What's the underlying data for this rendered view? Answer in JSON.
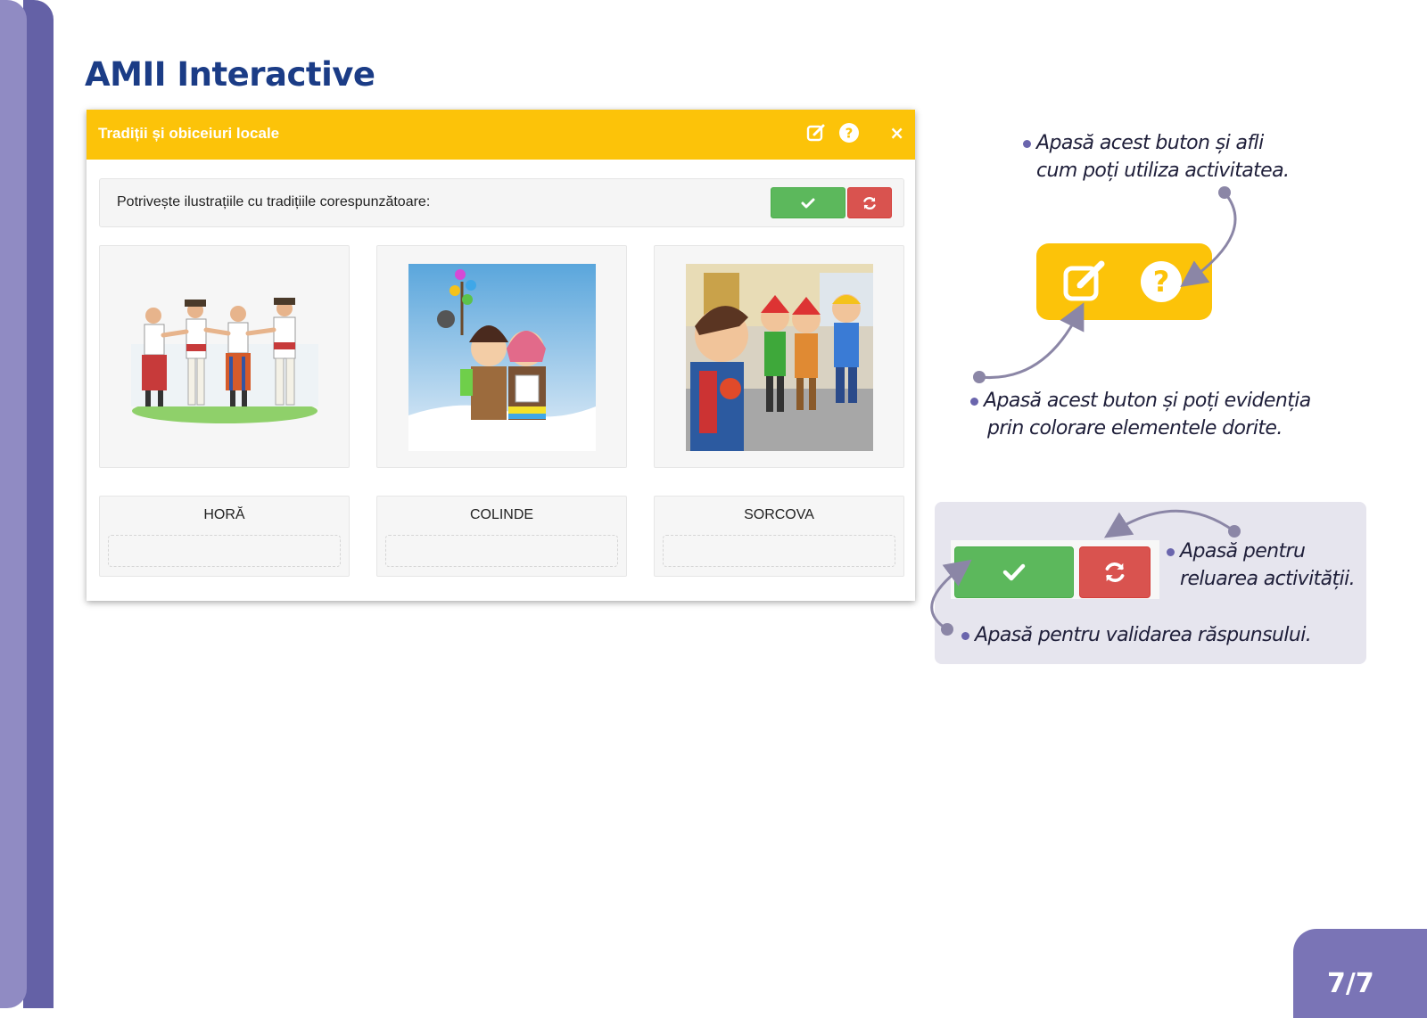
{
  "page": {
    "title": "AMII Interactive",
    "page_number": "7/7"
  },
  "window": {
    "title": "Tradiții și obiceiuri locale",
    "close_label": "×",
    "instruction": "Potrivește ilustrațiile cu tradițiile corespunzătoare:"
  },
  "cards": [
    {
      "label": "HORĂ"
    },
    {
      "label": "COLINDE"
    },
    {
      "label": "SORCOVA"
    }
  ],
  "notes": {
    "help_line1": "Apasă acest buton și afli",
    "help_line2": "cum poți utiliza activitatea.",
    "edit_line1": "Apasă acest buton și poți evidenția",
    "edit_line2": "prin colorare elementele dorite.",
    "reset_line1": "Apasă pentru",
    "reset_line2": "reluarea activității.",
    "check_line": "Apasă pentru validarea răspunsului."
  },
  "colors": {
    "header_yellow": "#fcc309",
    "check_green": "#5cb85c",
    "reset_red": "#d9534f",
    "title_blue": "#1b3c86",
    "side_purple": "#6461a6"
  },
  "icons": [
    "edit-icon",
    "help-icon",
    "close-icon",
    "check-icon",
    "refresh-icon"
  ]
}
